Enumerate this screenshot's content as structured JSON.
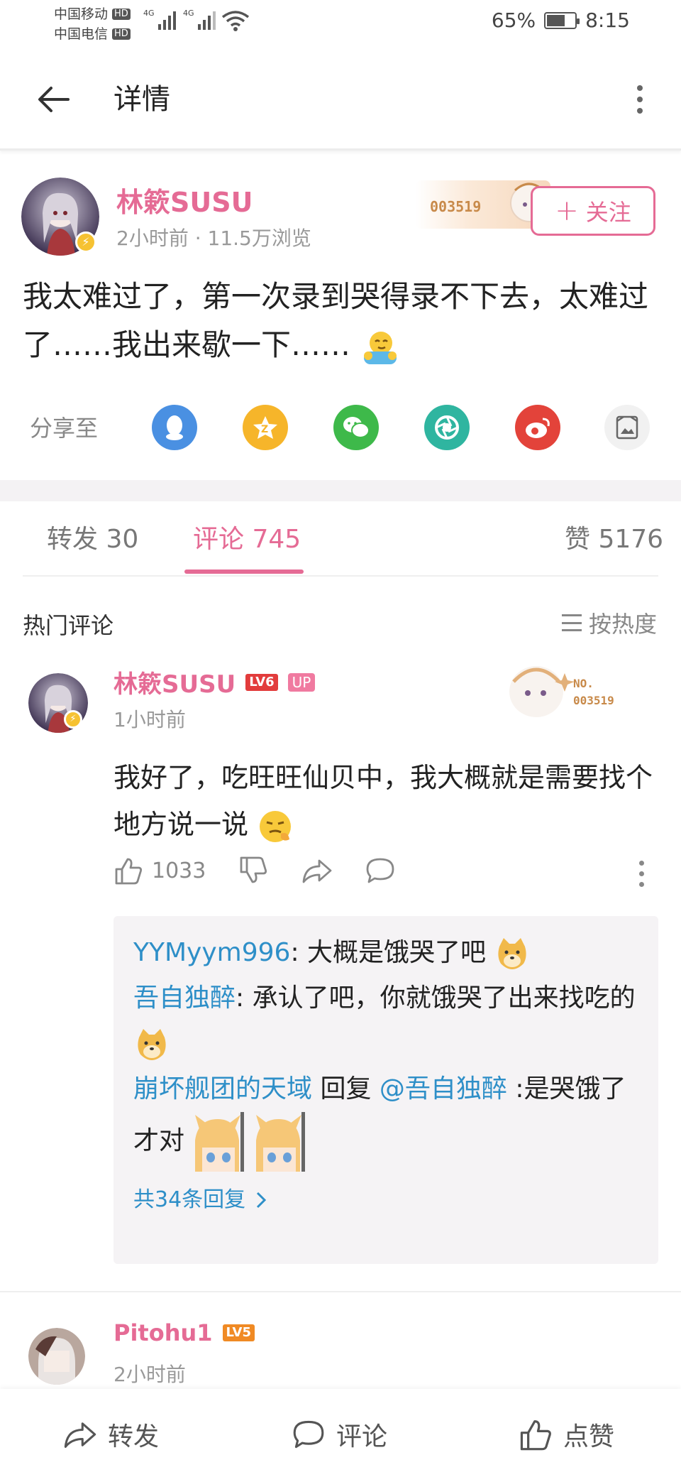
{
  "status_bar": {
    "carrier1": "中国移动",
    "carrier2": "中国电信",
    "hd": "HD",
    "net1": "4G",
    "net2": "4G",
    "battery": "65%",
    "battery_level": 0.65,
    "time": "8:15"
  },
  "appbar": {
    "title": "详情"
  },
  "post": {
    "author": "林簌SUSU",
    "meta": "2小时前 · 11.5万浏览",
    "deco_number": "003519",
    "follow_label": "关注",
    "text": "我太难过了，第一次录到哭得录不下去，太难过了……我出来歇一下……"
  },
  "share": {
    "label": "分享至",
    "targets": [
      "qq-icon",
      "qzone-icon",
      "wechat-icon",
      "moments-icon",
      "weibo-icon",
      "poster-icon"
    ]
  },
  "tabs": {
    "repost": "转发 30",
    "comments": "评论 745",
    "likes": "赞 5176"
  },
  "hot": {
    "title": "热门评论",
    "sort": "按热度"
  },
  "comment1": {
    "author": "林簌SUSU",
    "level": "LV6",
    "up_tag": "UP",
    "time": "1小时前",
    "deco_no": "NO.",
    "deco_number": "003519",
    "text": "我好了，吃旺旺仙贝中，我大概就是需要找个地方说一说",
    "like_count": "1033",
    "replies": [
      {
        "name": "YYMyym996",
        "sep": ": ",
        "text": "大概是饿哭了吧"
      },
      {
        "name": "吾自独醉",
        "sep": ": ",
        "text": "承认了吧，你就饿哭了出来找吃的"
      },
      {
        "name": "崩坏舰团的天域",
        "reply_word": " 回复 ",
        "mention": "@吾自独醉",
        "sep": " :",
        "text": "是哭饿了才对"
      }
    ],
    "more_replies": "共34条回复"
  },
  "comment2": {
    "author": "Pitohu1",
    "level": "LV5",
    "time": "2小时前"
  },
  "bottom": {
    "repost": "转发",
    "comment": "评论",
    "like": "点赞"
  },
  "colors": {
    "accent": "#e56b95",
    "link": "#2e8fc8"
  }
}
